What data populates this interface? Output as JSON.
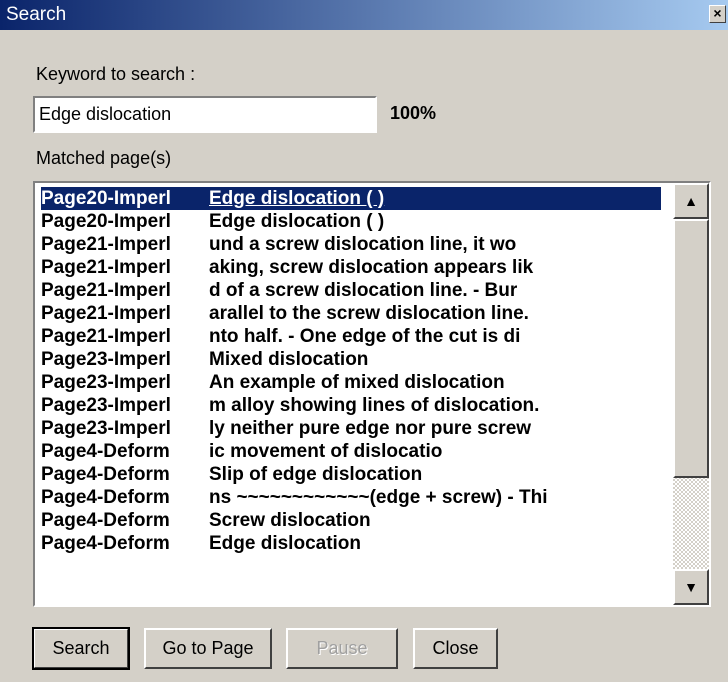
{
  "window": {
    "title": "Search",
    "close_glyph": "×"
  },
  "search": {
    "keyword_label": "Keyword to search :",
    "keyword_value": "Edge dislocation",
    "progress_text": "100%",
    "progress": 100
  },
  "results": {
    "label": "Matched page(s)",
    "selected_index": 0,
    "rows": [
      {
        "page": "Page20-Imperl",
        "snippet": "Edge dislocation (    )"
      },
      {
        "page": "Page20-Imperl",
        "snippet": "Edge dislocation (    )"
      },
      {
        "page": "Page21-Imperl",
        "snippet": "und a screw dislocation line, it wo"
      },
      {
        "page": "Page21-Imperl",
        "snippet": "aking, screw dislocation appears lik"
      },
      {
        "page": "Page21-Imperl",
        "snippet": "d of a screw dislocation line. -  Bur"
      },
      {
        "page": "Page21-Imperl",
        "snippet": "arallel to the screw dislocation line."
      },
      {
        "page": "Page21-Imperl",
        "snippet": "nto half. -  One edge of the cut is di"
      },
      {
        "page": "Page23-Imperl",
        "snippet": "Mixed dislocation"
      },
      {
        "page": "Page23-Imperl",
        "snippet": "An example of mixed dislocation"
      },
      {
        "page": "Page23-Imperl",
        "snippet": "m alloy showing lines of dislocation."
      },
      {
        "page": "Page23-Imperl",
        "snippet": "ly neither pure edge nor pure screw"
      },
      {
        "page": "Page4-Deform",
        "snippet": "ic movement of dislocatio"
      },
      {
        "page": "Page4-Deform",
        "snippet": "Slip of edge dislocation"
      },
      {
        "page": "Page4-Deform",
        "snippet": "ns ~~~~~~~~~~~~(edge + screw)  - Thi"
      },
      {
        "page": "Page4-Deform",
        "snippet": "Screw dislocation"
      },
      {
        "page": "Page4-Deform",
        "snippet": "Edge dislocation"
      }
    ]
  },
  "scrollbar": {
    "up_glyph": "▲",
    "down_glyph": "▼"
  },
  "buttons": {
    "search": "Search",
    "goto": "Go to Page",
    "pause": "Pause",
    "close": "Close"
  },
  "colors": {
    "title_bar": "#0a246a",
    "selection": "#0a246a",
    "face": "#d4d0c8"
  }
}
